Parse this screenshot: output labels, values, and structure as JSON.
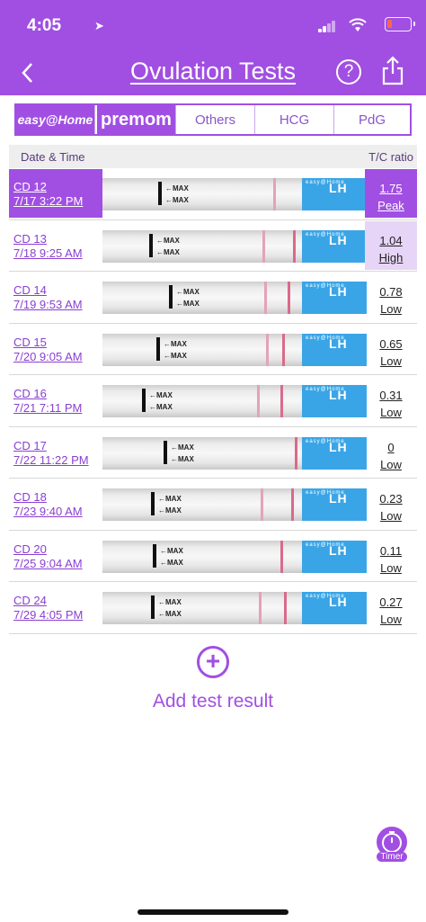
{
  "status": {
    "time": "4:05"
  },
  "nav": {
    "title": "Ovulation Tests",
    "help": "?"
  },
  "tabs": [
    "easy@Home",
    "premom",
    "Others",
    "HCG",
    "PdG"
  ],
  "table": {
    "header_date": "Date & Time",
    "header_ratio": "T/C ratio",
    "rows": [
      {
        "cd": "CD 12",
        "dt": "7/17 3:22 PM",
        "value": "1.75",
        "level": "Peak"
      },
      {
        "cd": "CD 13",
        "dt": "7/18 9:25 AM",
        "value": "1.04",
        "level": "High"
      },
      {
        "cd": "CD 14",
        "dt": "7/19 9:53 AM",
        "value": "0.78",
        "level": "Low"
      },
      {
        "cd": "CD 15",
        "dt": "7/20 9:05 AM",
        "value": "0.65",
        "level": "Low"
      },
      {
        "cd": "CD 16",
        "dt": "7/21 7:11 PM",
        "value": "0.31",
        "level": "Low"
      },
      {
        "cd": "CD 17",
        "dt": "7/22 11:22 PM",
        "value": "0",
        "level": "Low"
      },
      {
        "cd": "CD 18",
        "dt": "7/23 9:40 AM",
        "value": "0.23",
        "level": "Low"
      },
      {
        "cd": "CD 20",
        "dt": "7/25 9:04 AM",
        "value": "0.11",
        "level": "Low"
      },
      {
        "cd": "CD 24",
        "dt": "7/29 4:05 PM",
        "value": "0.27",
        "level": "Low"
      }
    ]
  },
  "strip_labels": {
    "max": "←MAX",
    "lh": "LH",
    "brand": "easy@Home"
  },
  "add": {
    "label": "Add test result"
  },
  "timer": {
    "label": "Timer"
  },
  "colors": {
    "accent": "#a14fe2",
    "high_bg": "#e6d5f7",
    "lh_pad": "#3aa5e6"
  }
}
